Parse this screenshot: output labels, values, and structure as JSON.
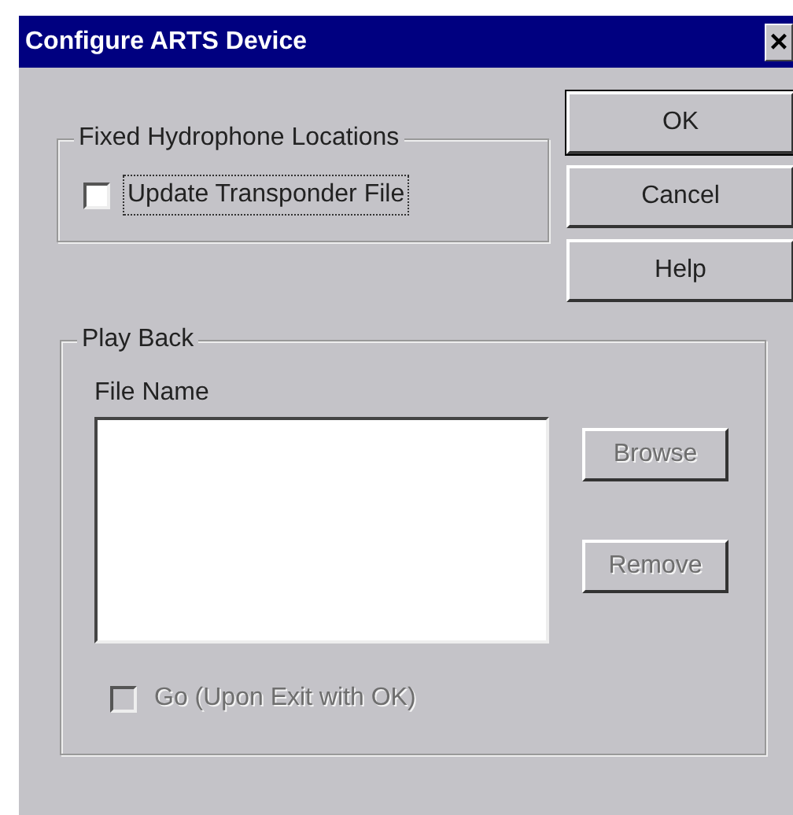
{
  "window": {
    "title": "Configure ARTS Device",
    "close": "×"
  },
  "fixed_group": {
    "title": "Fixed Hydrophone Locations",
    "checkbox": {
      "label": "Update Transponder File",
      "checked": false,
      "focused": true
    }
  },
  "buttons": [
    {
      "label": "OK",
      "default": true
    },
    {
      "label": "Cancel",
      "default": false
    },
    {
      "label": "Help",
      "default": false
    }
  ],
  "playback_group": {
    "title": "Play Back",
    "list_label": "File Name",
    "side_buttons": [
      {
        "label": "Browse",
        "disabled": true
      },
      {
        "label": "Remove",
        "disabled": true
      }
    ],
    "checkbox": {
      "label": "Go (Upon Exit with OK)",
      "checked": false,
      "disabled": true
    }
  }
}
